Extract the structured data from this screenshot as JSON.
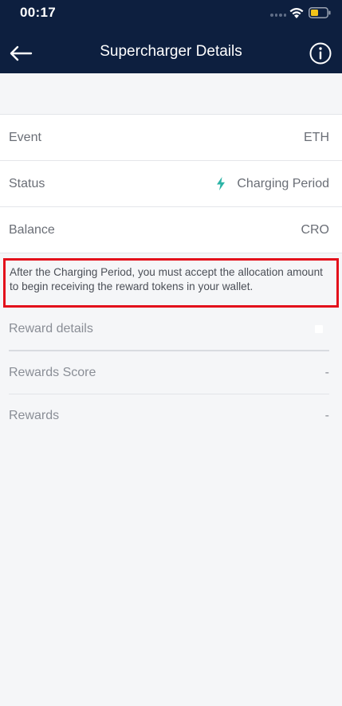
{
  "status_bar": {
    "time": "00:17",
    "icons": [
      "signal-icon",
      "wifi-icon",
      "battery-icon"
    ]
  },
  "header": {
    "title": "Supercharger Details",
    "back_icon": "arrow-left-icon",
    "info_icon": "info-icon"
  },
  "details": {
    "event": {
      "label": "Event",
      "value": "ETH"
    },
    "status": {
      "label": "Status",
      "value": "Charging Period",
      "icon": "lightning-bolt-icon",
      "icon_color": "#2bb3a6"
    },
    "balance": {
      "label": "Balance",
      "value": "CRO"
    }
  },
  "notice": {
    "text": "After the Charging Period, you must accept the allocation amount to begin receiving the reward tokens in your wallet.",
    "border_color": "#e3101b"
  },
  "rewards": {
    "details_label": "Reward details",
    "score": {
      "label": "Rewards Score",
      "value": "-"
    },
    "rewards": {
      "label": "Rewards",
      "value": "-"
    }
  },
  "colors": {
    "header_bg": "#0d1f3f",
    "page_bg": "#f5f6f8",
    "text_muted": "#6a6e76"
  }
}
